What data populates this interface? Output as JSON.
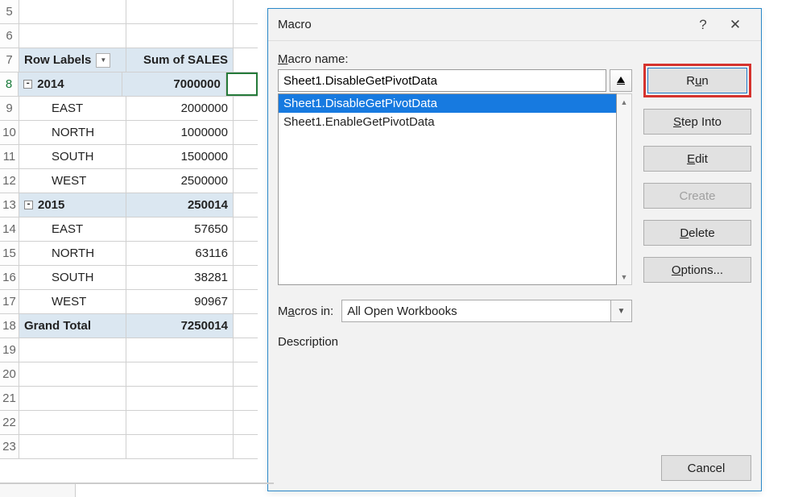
{
  "rows": [
    {
      "num": "5",
      "a": "",
      "b": ""
    },
    {
      "num": "6",
      "a": "",
      "b": ""
    },
    {
      "num": "7",
      "a": "Row Labels",
      "b": "Sum of SALES",
      "hdr": true,
      "filter": true
    },
    {
      "num": "8",
      "a": "2014",
      "b": "7000000",
      "group": true,
      "subtotal": true,
      "selRow": true,
      "selCellC": true
    },
    {
      "num": "9",
      "a": "EAST",
      "b": "2000000",
      "indent": true
    },
    {
      "num": "10",
      "a": "NORTH",
      "b": "1000000",
      "indent": true
    },
    {
      "num": "11",
      "a": "SOUTH",
      "b": "1500000",
      "indent": true
    },
    {
      "num": "12",
      "a": "WEST",
      "b": "2500000",
      "indent": true
    },
    {
      "num": "13",
      "a": "2015",
      "b": "250014",
      "group": true,
      "subtotal": true
    },
    {
      "num": "14",
      "a": "EAST",
      "b": "57650",
      "indent": true
    },
    {
      "num": "15",
      "a": "NORTH",
      "b": "63116",
      "indent": true
    },
    {
      "num": "16",
      "a": "SOUTH",
      "b": "38281",
      "indent": true
    },
    {
      "num": "17",
      "a": "WEST",
      "b": "90967",
      "indent": true
    },
    {
      "num": "18",
      "a": "Grand Total",
      "b": "7250014",
      "subtotal": true
    },
    {
      "num": "19",
      "a": "",
      "b": ""
    },
    {
      "num": "20",
      "a": "",
      "b": ""
    },
    {
      "num": "21",
      "a": "",
      "b": ""
    },
    {
      "num": "22",
      "a": "",
      "b": ""
    },
    {
      "num": "23",
      "a": "",
      "b": ""
    }
  ],
  "dialog": {
    "title": "Macro",
    "help": "?",
    "close": "✕",
    "macro_name_prefix": "M",
    "macro_name_rest": "acro name:",
    "name_value": "Sheet1.DisableGetPivotData",
    "list": [
      {
        "label": "Sheet1.DisableGetPivotData",
        "selected": true
      },
      {
        "label": "Sheet1.EnableGetPivotData",
        "selected": false
      }
    ],
    "macros_in_prefix": "M",
    "macros_in_mid": "a",
    "macros_in_rest": "cros in:",
    "macros_in_value": "All Open Workbooks",
    "description": "Description",
    "buttons": {
      "run_prefix": "R",
      "run_ul": "u",
      "run_rest": "n",
      "step_prefix": "",
      "step_ul": "S",
      "step_rest": "tep Into",
      "edit_prefix": "",
      "edit_ul": "E",
      "edit_rest": "dit",
      "create_prefix": "",
      "create_ul": "C",
      "create_rest": "reate",
      "delete_prefix": "",
      "delete_ul": "D",
      "delete_rest": "elete",
      "options_prefix": "",
      "options_ul": "O",
      "options_rest": "ptions...",
      "cancel": "Cancel"
    }
  }
}
